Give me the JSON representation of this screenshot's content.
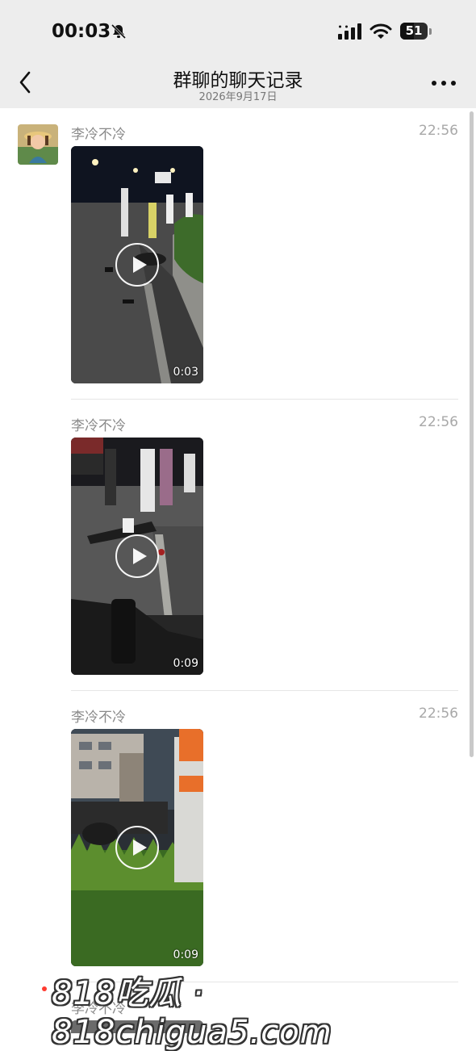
{
  "status_bar": {
    "time": "00:03",
    "battery": "51"
  },
  "header": {
    "title": "群聊的聊天记录",
    "date": "2026年9月17日"
  },
  "messages": [
    {
      "sender": "李冷不冷",
      "time": "22:56",
      "duration": "0:03"
    },
    {
      "sender": "李冷不冷",
      "time": "22:56",
      "duration": "0:09"
    },
    {
      "sender": "李冷不冷",
      "time": "22:56",
      "duration": "0:09"
    },
    {
      "sender": "李冷不冷"
    }
  ],
  "watermark": "818吃瓜 · 818chigua5.com",
  "icons": [
    "bell-muted-icon",
    "cellular-signal-icon",
    "wifi-icon",
    "battery-icon",
    "back-icon",
    "more-icon",
    "play-icon"
  ]
}
